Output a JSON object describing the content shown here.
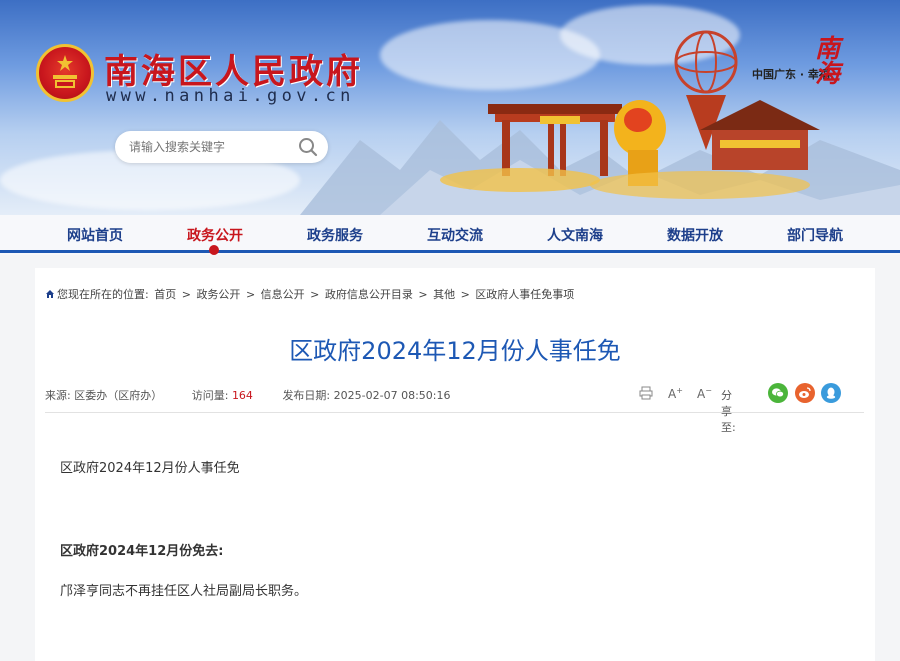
{
  "header": {
    "site_title": "南海区人民政府",
    "site_url": "www.nanhai.gov.cn",
    "slogan": "中国广东 · 幸福",
    "seal_text": "南 海",
    "search_placeholder": "请输入搜索关键字"
  },
  "nav": {
    "items": [
      "网站首页",
      "政务公开",
      "政务服务",
      "互动交流",
      "人文南海",
      "数据开放",
      "部门导航"
    ],
    "active_index": 1
  },
  "breadcrumb": {
    "prefix": "您现在所在的位置:",
    "items": [
      "首页",
      "政务公开",
      "信息公开",
      "政府信息公开目录",
      "其他",
      "区政府人事任免事项"
    ],
    "separator": ">"
  },
  "article": {
    "title": "区政府2024年12月份人事任免",
    "source_label": "来源:",
    "source_value": "区委办（区府办）",
    "views_label": "访问量:",
    "views_value": "164",
    "date_label": "发布日期:",
    "date_value": "2025-02-07 08:50:16",
    "share_label": "分享至:",
    "paragraphs": [
      "区政府2024年12月份人事任免",
      "区政府2024年12月份免去:",
      "邝泽亨同志不再挂任区人社局副局长职务。"
    ]
  },
  "tools": {
    "font_up": "A",
    "font_down": "A"
  },
  "colors": {
    "brand_red": "#c8161d",
    "brand_blue": "#1d58b4",
    "nav_text": "#1d3f8b"
  }
}
